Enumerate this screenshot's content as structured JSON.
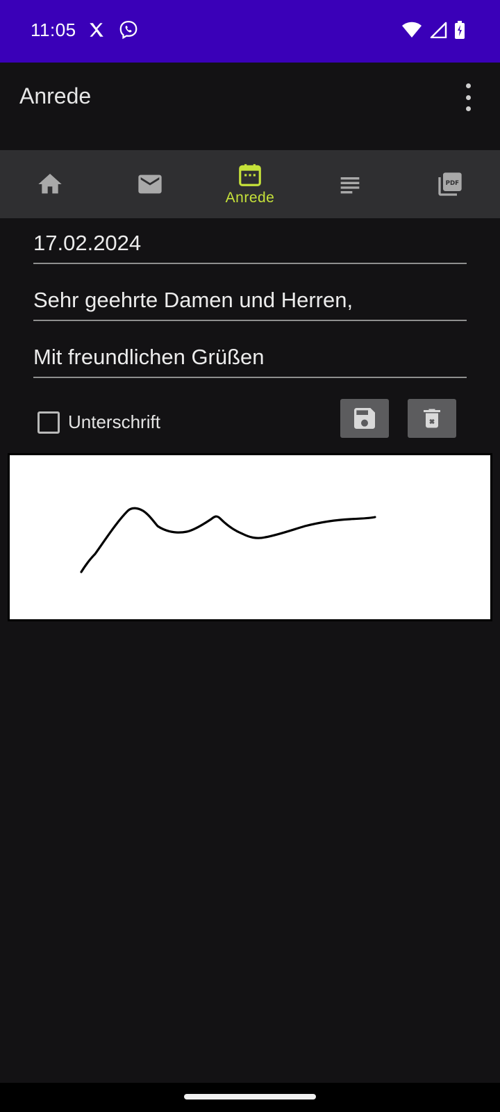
{
  "status_bar": {
    "time": "11:05",
    "background": "#3a00b8"
  },
  "app_bar": {
    "title": "Anrede"
  },
  "tabs": [
    {
      "icon": "home-icon",
      "label": ""
    },
    {
      "icon": "mail-icon",
      "label": ""
    },
    {
      "icon": "calendar-icon",
      "label": "Anrede",
      "selected": true
    },
    {
      "icon": "text-lines-icon",
      "label": ""
    },
    {
      "icon": "pdf-icon",
      "label": ""
    }
  ],
  "form": {
    "date": "17.02.2024",
    "greeting": "Sehr geehrte Damen und Herren,",
    "closing": "Mit freundlichen Grüßen",
    "signature_label": "Unterschrift",
    "signature_checked": false
  },
  "colors": {
    "accent": "#c6e23a",
    "background": "#131214",
    "tab_bar": "#2f2f31"
  }
}
